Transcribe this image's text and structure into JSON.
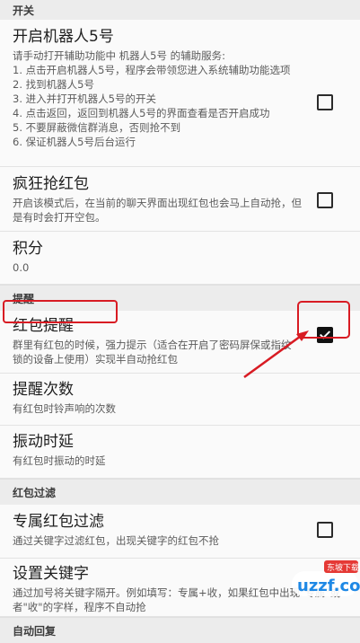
{
  "sections": {
    "switch": "开关",
    "remind": "提醒",
    "filter": "红包过滤",
    "autoreply": "自动回复"
  },
  "prefs": {
    "robot": {
      "title": "开启机器人5号",
      "summary": "请手动打开辅助功能中 机器人5号 的辅助服务:\n1. 点击开启机器人5号，程序会带领您进入系统辅助功能选项\n2. 找到机器人5号\n3. 进入并打开机器人5号的开关\n4. 点击返回，返回到机器人5号的界面查看是否开启成功\n5. 不要屏蔽微信群消息，否则抢不到\n6. 保证机器人5号后台运行",
      "checked": false
    },
    "crazy": {
      "title": "疯狂抢红包",
      "summary": "开启该模式后，在当前的聊天界面出现红包也会马上自动抢，但是有时会打开空包。",
      "checked": false
    },
    "points": {
      "title": "积分",
      "summary": "0.0"
    },
    "redpacket_remind": {
      "title": "红包提醒",
      "summary": "群里有红包的时候，强力提示（适合在开启了密码屏保或指纹锁的设备上使用）实现半自动抢红包",
      "checked": true
    },
    "remind_count": {
      "title": "提醒次数",
      "summary": "有红包时铃声响的次数"
    },
    "vibrate": {
      "title": "振动时延",
      "summary": "有红包时振动的时延"
    },
    "exclusive_filter": {
      "title": "专属红包过滤",
      "summary": "通过关键字过滤红包，出现关键字的红包不抢",
      "checked": false
    },
    "keywords": {
      "title": "设置关键字",
      "summary": "通过加号将关键字隔开。例如填写：专属+收，如果红包中出现\"专属\"或者\"收\"的字样，程序不自动抢"
    }
  },
  "watermark": {
    "text": "uzzf.com",
    "badge": "东坡下载"
  },
  "colors": {
    "highlight": "#d81b23",
    "watermark_blue": "#1e88e5"
  }
}
